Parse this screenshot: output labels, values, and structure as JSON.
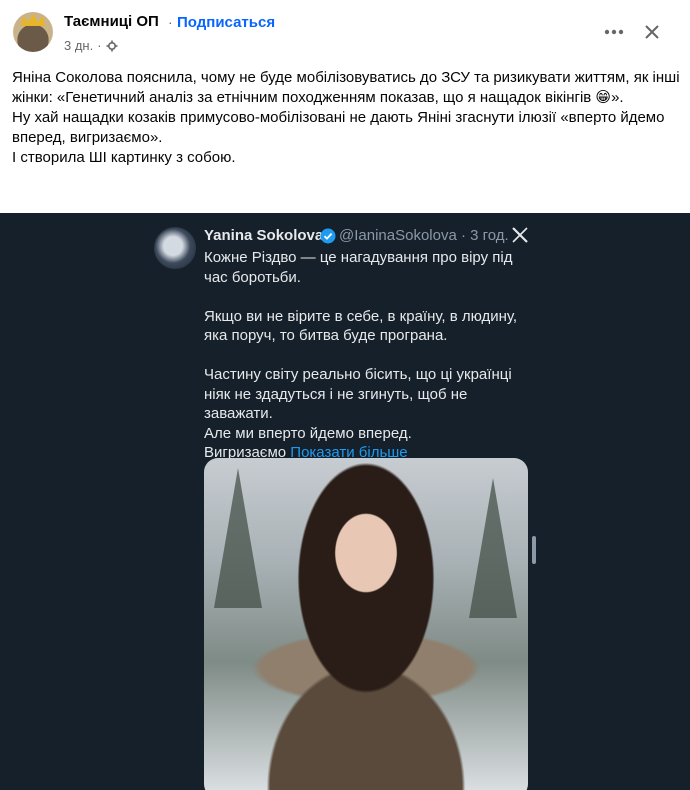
{
  "header": {
    "page_name": "Таємниці ОП",
    "separator": "·",
    "follow_label": "Подписаться",
    "time": "3 дн.",
    "time_separator": "·",
    "privacy_icon": "gear-globe-icon",
    "more_icon": "more-horizontal-icon",
    "close_icon": "close-icon"
  },
  "post": {
    "paragraphs": [
      "Яніна Соколова пояснила, чому не буде мобілізовуватись до ЗСУ та ризикувати життям, як інші жінки: «Генетичний аналіз за етнічним походженням показав, що я нащадок вікінгів 😁».",
      "Ну хай нащадки козаків примусово-мобілізовані не дають Яніні згаснути ілюзії «вперто йдемо вперед, вигризаємо».",
      "І створила ШІ картинку з собою."
    ]
  },
  "tweet": {
    "author_name": "Yanina Sokolova",
    "handle_time": "@IaninaSokolova · 3 год.",
    "paragraphs": [
      "Кожне Різдво — це нагадування про віру під час боротьби.",
      "Якщо ви не вірите в себе, в країну, в людину, яка поруч, то битва буде програна.",
      "Частину світу реально бісить, що ці українці ніяк не здадуться і не згинуть, щоб не заважати."
    ],
    "line_4": "Але ми вперто йдемо вперед.",
    "line_5": "Вигризаємо",
    "show_more_label": "Показати більше",
    "verified_icon": "verified-badge-icon",
    "x_icon": "x-logo-icon"
  },
  "colors": {
    "accent": "#0866ff",
    "tweet_bg": "#15202b",
    "tweet_link": "#1d9bf0"
  }
}
